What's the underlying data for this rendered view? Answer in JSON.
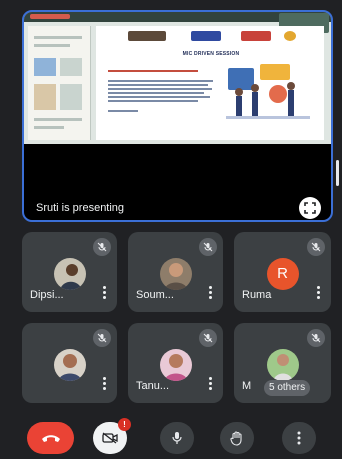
{
  "presentation": {
    "presenter_label": "Sruti is presenting",
    "slide_title": "MIC DRIVEN SESSION"
  },
  "participants": [
    {
      "name": "Dipsi...",
      "muted": true
    },
    {
      "name": "Soum...",
      "muted": true
    },
    {
      "name": "Ruma",
      "muted": true,
      "avatar_letter": "R",
      "avatar_color": "#e8542b"
    },
    {
      "name": "",
      "muted": true
    },
    {
      "name": "Tanu...",
      "muted": true
    },
    {
      "name": "M",
      "muted": true,
      "others_label": "5 others"
    }
  ],
  "controls": {
    "camera_badge": "!"
  },
  "colors": {
    "background": "#202124",
    "tile": "#3c4043",
    "presenter_border": "#3b6fd6",
    "end_call": "#ea4335",
    "control": "#3c4043"
  },
  "icons": [
    "mic-off-icon",
    "more-vert-icon",
    "fullscreen-icon",
    "end-call-icon",
    "camera-off-icon",
    "mic-icon",
    "raise-hand-icon"
  ]
}
